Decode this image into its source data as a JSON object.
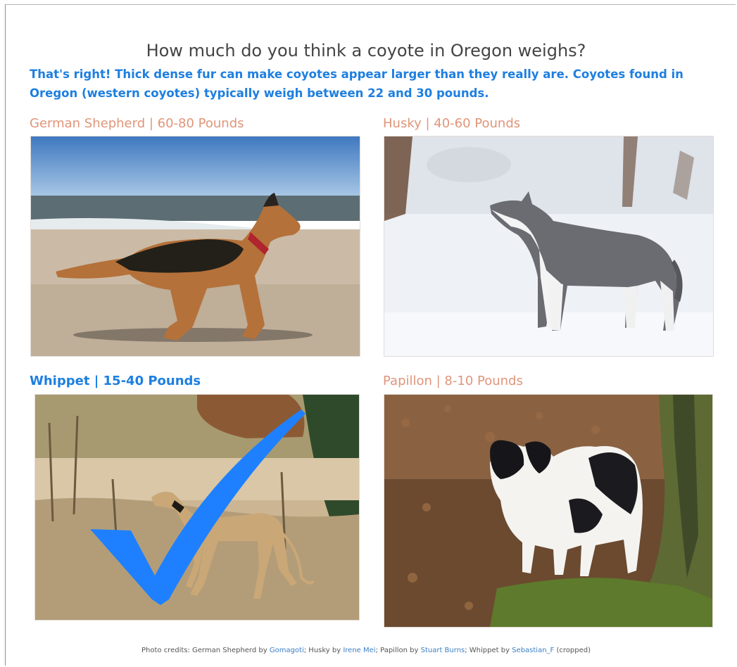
{
  "question": "How much do you think a coyote in Oregon weighs?",
  "feedback": "That's right! Thick dense fur can make coyotes appear larger than they really are. Coyotes found in Oregon (western coyotes) typically weigh between 22 and 30 pounds.",
  "options": [
    {
      "label": "German Shepherd | 60-80 Pounds",
      "image": "german-shepherd-on-beach"
    },
    {
      "label": "Husky | 40-60 Pounds",
      "image": "husky-in-snow"
    },
    {
      "label": "Whippet | 15-40 Pounds",
      "image": "whippet-in-dry-grass",
      "selected": true
    },
    {
      "label": "Papillon | 8-10 Pounds",
      "image": "papillon-by-tree"
    }
  ],
  "checkmark_icon": "checkmark-icon",
  "colors": {
    "accent": "#1e7fe0",
    "option_text": "#e0957a",
    "heading": "#444444"
  },
  "credits": {
    "prefix": "Photo credits: German Shepherd by ",
    "gs_author": "Gomagoti",
    "husky_prefix": "; Husky by ",
    "husky_author": "Irene Mei",
    "papillon_prefix": "; Papillon by ",
    "papillon_author": "Stuart Burns",
    "whippet_prefix": "; Whippet by ",
    "whippet_author": "Sebastian_F",
    "suffix": " (cropped)"
  }
}
